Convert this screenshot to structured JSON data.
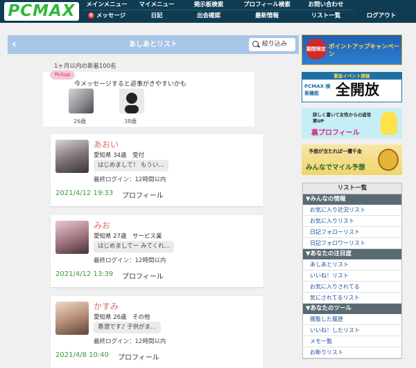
{
  "header": {
    "logo": "PCMAX",
    "nav_row1": [
      "メインメニュー",
      "マイメニュー",
      "掲示板検索",
      "プロフィール検索",
      "お問い合わせ"
    ],
    "nav_row2": [
      "メッセージ",
      "日記",
      "出会確認",
      "最新情報",
      "リスト一覧",
      "ログアウト"
    ],
    "message_badge": "0"
  },
  "titlebar": {
    "back": "‹",
    "title": "あしあとリスト",
    "filter_label": "絞り込み"
  },
  "pickup": {
    "heading": "1ヶ月以内の新着100名",
    "tag": "Pickup",
    "message": "今メッセージすると返事がきやすいかも",
    "users": [
      {
        "age": "26歳"
      },
      {
        "age": "38歳"
      }
    ]
  },
  "cards": [
    {
      "name": "あおい",
      "info": "愛知県 34歳　受付",
      "message": "はじめまして！ もうい…",
      "login": "最終ログイン：12時間以内",
      "date": "2021/4/12 19:33",
      "profile": "プロフィール"
    },
    {
      "name": "みお",
      "info": "愛知県 27歳　サービス業",
      "message": "はじめましてー みてくれ…",
      "login": "最終ログイン：12時間以内",
      "date": "2021/4/12 13:39",
      "profile": "プロフィール"
    },
    {
      "name": "かすみ",
      "info": "愛知県 26歳　その他",
      "message": "香澄です♪ 子供がま…",
      "login": "最終ログイン：12時間以内",
      "date": "2021/4/8 10:40",
      "profile": "プロフィール"
    }
  ],
  "ads": [
    {
      "title": "ポイントアップキャンペーン",
      "tag": "期間限定"
    },
    {
      "title": "全開放",
      "sub": "PCMAX 検索機能",
      "top": "緊急イベント開催"
    },
    {
      "title": "裏プロフィール",
      "sub": "詳しく書いて女性からの返信率UP"
    },
    {
      "title": "みんなでマイル予想",
      "sub": "予想が当たれば一攫千金"
    }
  ],
  "sidebar": {
    "title": "リスト一覧",
    "sections": [
      {
        "label": "▼みんなの情報",
        "items": [
          "お気に入り近況リスト",
          "お気に入りリスト",
          "日記フォローリスト",
          "日記フォロワーリスト"
        ]
      },
      {
        "label": "▼あなたの注目度",
        "items": [
          "あしあとリスト",
          "いいね！リスト",
          "お気に入りされてる",
          "気にされてるリスト"
        ]
      },
      {
        "label": "▼あなたのツール",
        "items": [
          "閲覧した履歴",
          "いいね！したリスト",
          "メモ一覧",
          "お断りリスト"
        ]
      }
    ]
  },
  "colors": {
    "header_bg": "#0f3c52",
    "titlebar_bg": "#a7c6e8",
    "name_pink": "#e56a6a",
    "date_green": "#3a9a3a"
  }
}
